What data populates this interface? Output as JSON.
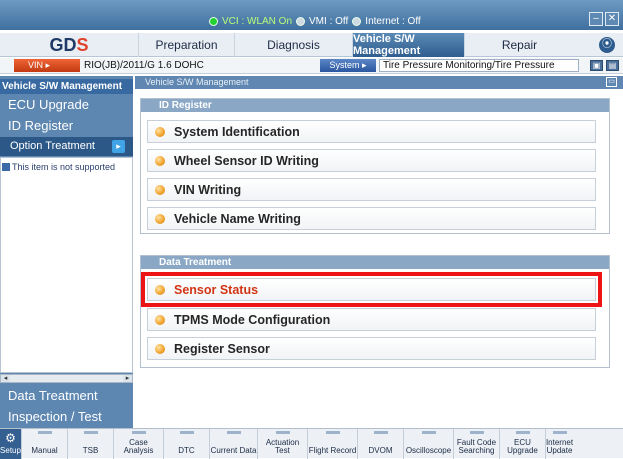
{
  "status": {
    "vci": "VCI : WLAN On",
    "vmi": "VMI : Off",
    "internet": "Internet : Off"
  },
  "window": {
    "minimize": "–",
    "close": "✕"
  },
  "logo": {
    "text_main": "GD",
    "text_accent": "S"
  },
  "nav": {
    "tabs": [
      "Preparation",
      "Diagnosis",
      "Vehicle S/W Management",
      "Repair"
    ],
    "active": "Vehicle S/W Management",
    "search_icon": "⦿"
  },
  "vehicle": {
    "vin_label": "VIN",
    "vehicle_text": "RIO(JB)/2011/G 1.6 DOHC",
    "system_label": "System",
    "system_value": "Tire Pressure Monitoring/Tire Pressure",
    "btn1": "▣",
    "btn2": "▤"
  },
  "sidebar": {
    "header": "Vehicle S/W Management",
    "items": [
      "ECU Upgrade",
      "ID Register",
      "Option Treatment"
    ],
    "note": "This item is not supported",
    "bottom_items": [
      "Data Treatment",
      "Inspection / Test"
    ],
    "scroll_left": "◂",
    "scroll_right": "▸",
    "arrow": "▸"
  },
  "main": {
    "breadcrumb": "Vehicle S/W Management",
    "icon": "▭",
    "id_register": {
      "title": "ID Register",
      "items": [
        "System Identification",
        "Wheel Sensor ID Writing",
        "VIN Writing",
        "Vehicle Name Writing"
      ]
    },
    "data_treatment": {
      "title": "Data Treatment",
      "items": [
        "Sensor Status",
        "TPMS Mode Configuration",
        "Register Sensor"
      ]
    }
  },
  "toolbar": {
    "setup": "Setup",
    "items": [
      "Manual",
      "TSB",
      "Case Analysis",
      "DTC",
      "Current Data",
      "Actuation Test",
      "Flight Record",
      "DVOM",
      "Oscilloscope",
      "Fault Code Searching",
      "ECU Upgrade",
      "Internet Update"
    ]
  },
  "colors": {
    "highlight": "#ec1414",
    "nav_active": "#2f5d8f",
    "sidebar": "#5d86b1"
  }
}
